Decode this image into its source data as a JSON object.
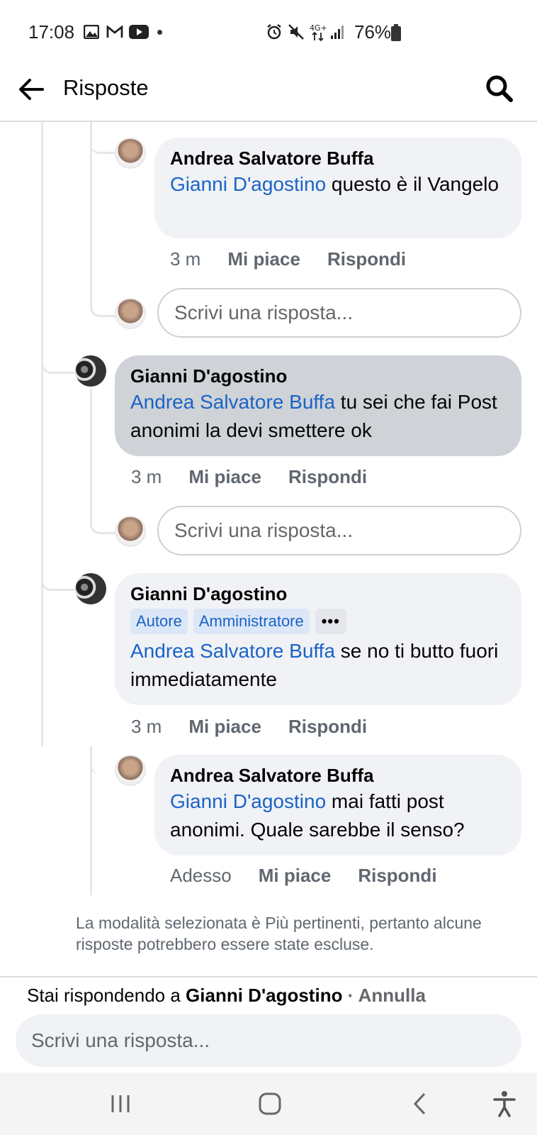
{
  "status_bar": {
    "time": "17:08",
    "battery": "76%",
    "left_icons": [
      "image-icon",
      "gmail-icon",
      "youtube-icon",
      "dot-icon"
    ],
    "right_icons": [
      "alarm-icon",
      "mute-icon",
      "4g-icon",
      "signal-icon",
      "battery-icon"
    ]
  },
  "header": {
    "title": "Risposte"
  },
  "comments": [
    {
      "author": "Andrea Salvatore Buffa",
      "mention": "Gianni D'agostino",
      "text": " questo è il Vangelo",
      "time": "3 m",
      "like": "Mi piace",
      "reply": "Rispondi"
    },
    {
      "author": "Gianni D'agostino",
      "mention": "Andrea Salvatore Buffa",
      "text": " tu sei che fai Post anonimi la devi smettere ok",
      "time": "3 m",
      "like": "Mi piace",
      "reply": "Rispondi"
    },
    {
      "author": "Gianni D'agostino",
      "badges": [
        "Autore",
        "Amministratore"
      ],
      "more": "•••",
      "mention": "Andrea Salvatore Buffa",
      "text": " se no ti butto fuori immediatamente",
      "time": "3 m",
      "like": "Mi piace",
      "reply": "Rispondi"
    },
    {
      "author": "Andrea Salvatore Buffa",
      "mention": "Gianni D'agostino",
      "text": " mai fatti post anonimi. Quale sarebbe il senso?",
      "time": "Adesso",
      "like": "Mi piace",
      "reply": "Rispondi"
    }
  ],
  "reply_placeholder": "Scrivi una risposta...",
  "notice": "La modalità selezionata è Più pertinenti, pertanto alcune risposte potrebbero essere state escluse.",
  "composer": {
    "prefix": "Stai rispondendo a ",
    "target": "Gianni D'agostino",
    "separator": " · ",
    "cancel": "Annulla",
    "placeholder": "Scrivi una risposta..."
  },
  "navbar": {
    "buttons": [
      "recents-icon",
      "home-icon",
      "back-icon",
      "accessibility-icon"
    ]
  }
}
